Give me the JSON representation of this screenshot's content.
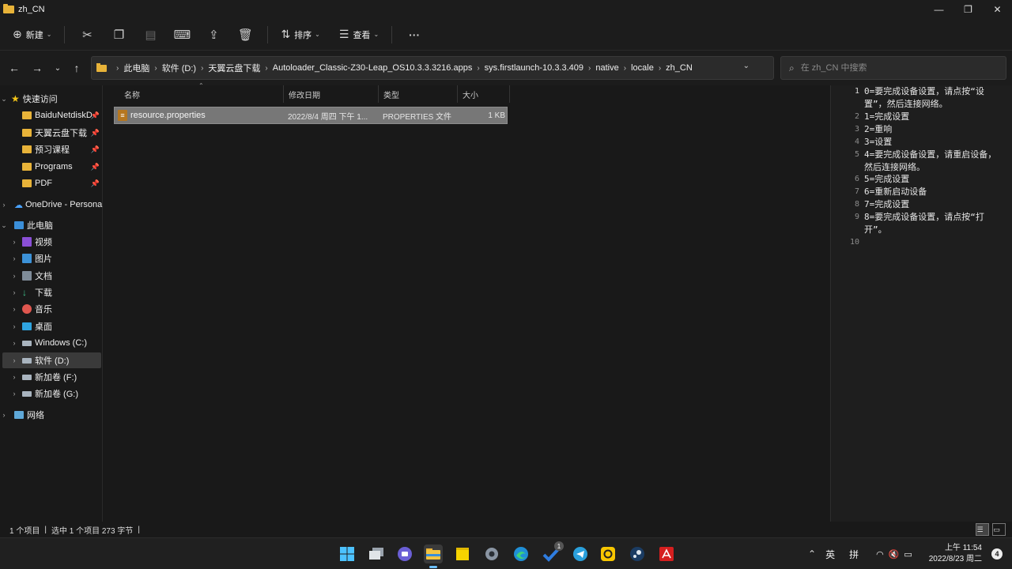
{
  "window": {
    "title": "zh_CN",
    "minimize": "—",
    "maximize": "❐",
    "close": "✕"
  },
  "toolbar": {
    "new_label": "新建",
    "sort_label": "排序",
    "view_label": "查看",
    "more": "···"
  },
  "address": {
    "crumbs": [
      "此电脑",
      "软件 (D:)",
      "天翼云盘下载",
      "Autoloader_Classic-Z30-Leap_OS10.3.3.3216.apps",
      "sys.firstlaunch-10.3.3.409",
      "native",
      "locale",
      "zh_CN"
    ],
    "search_placeholder": "在 zh_CN 中搜索"
  },
  "sidebar": {
    "quick_access": "快速访问",
    "quick_items": [
      "BaiduNetdiskD",
      "天翼云盘下载",
      "预习课程",
      "Programs",
      "PDF"
    ],
    "onedrive": "OneDrive - Persona",
    "this_pc": "此电脑",
    "pc_items": [
      "视频",
      "图片",
      "文档",
      "下载",
      "音乐",
      "桌面",
      "Windows (C:)",
      "软件 (D:)",
      "新加卷 (F:)",
      "新加卷 (G:)"
    ],
    "network": "网络"
  },
  "columns": {
    "name": "名称",
    "modified": "修改日期",
    "type": "类型",
    "size": "大小"
  },
  "file": {
    "name": "resource.properties",
    "modified": "2022/8/4 周四 下午 1...",
    "type": "PROPERTIES 文件",
    "size": "1 KB"
  },
  "preview": {
    "lines": [
      {
        "n": "1",
        "t": "0=要完成设备设置，请点按“设置”，然后连接网络。"
      },
      {
        "n": "2",
        "t": "1=完成设置"
      },
      {
        "n": "3",
        "t": "2=重响"
      },
      {
        "n": "4",
        "t": "3=设置"
      },
      {
        "n": "5",
        "t": "4=要完成设备设置，请重启设备，然后连接网络。"
      },
      {
        "n": "6",
        "t": "5=完成设置"
      },
      {
        "n": "7",
        "t": "6=重新启动设备"
      },
      {
        "n": "8",
        "t": "7=完成设置"
      },
      {
        "n": "9",
        "t": "8=要完成设备设置，请点按“打开”。"
      },
      {
        "n": "10",
        "t": ""
      }
    ]
  },
  "status": {
    "count": "1 个项目",
    "selected": "选中 1 个项目  273 字节"
  },
  "taskbar": {
    "ime_lang": "英",
    "ime_mode": "拼",
    "time": "上午 11:54",
    "date": "2022/8/23 周二",
    "notifications": "4",
    "todo_badge": "1"
  }
}
